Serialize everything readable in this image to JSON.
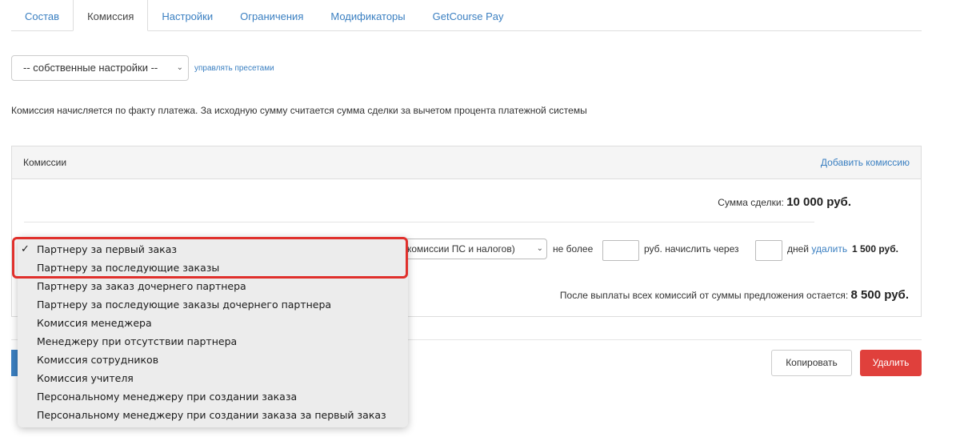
{
  "tabs": [
    {
      "label": "Состав",
      "active": false
    },
    {
      "label": "Комиссия",
      "active": true
    },
    {
      "label": "Настройки",
      "active": false
    },
    {
      "label": "Ограничения",
      "active": false
    },
    {
      "label": "Модификаторы",
      "active": false
    },
    {
      "label": "GetCourse Pay",
      "active": false
    }
  ],
  "preset": {
    "selected": "-- собственные настройки --",
    "manage_link": "управлять пресетами"
  },
  "info_text": "Комиссия начисляется по факту платежа. За исходную сумму считается сумма сделки за вычетом процента платежной системы",
  "panel": {
    "title": "Комиссии",
    "add_link": "Добавить комиссию",
    "deal_label": "Сумма сделки:",
    "deal_value": "10 000 руб.",
    "row": {
      "base_select": "комиссии ПС и налогов)",
      "not_more": "не более",
      "currency_after": "руб. начислить через",
      "days": "дней",
      "delete_link": "удалить",
      "amount": "1 500 руб."
    },
    "remain_label": "После выплаты всех комиссий от суммы предложения остается:",
    "remain_value": "8 500 руб."
  },
  "buttons": {
    "copy": "Копировать",
    "delete": "Удалить"
  },
  "dropdown": {
    "checkmark": "✓",
    "options": [
      "Партнеру за первый заказ",
      "Партнеру за последующие заказы",
      "Партнеру за заказ дочернего партнера",
      "Партнеру за последующие заказы дочернего партнера",
      "Комиссия менеджера",
      "Менеджеру при отсутствии партнера",
      "Комиссия сотрудников",
      "Комиссия учителя",
      "Персональному менеджеру при создании заказа",
      "Персональному менеджеру при создании заказа за первый заказ"
    ],
    "selected_index": 0
  },
  "colors": {
    "accent": "#3a7fc1",
    "danger": "#e0403c",
    "highlight": "#e0302c"
  }
}
